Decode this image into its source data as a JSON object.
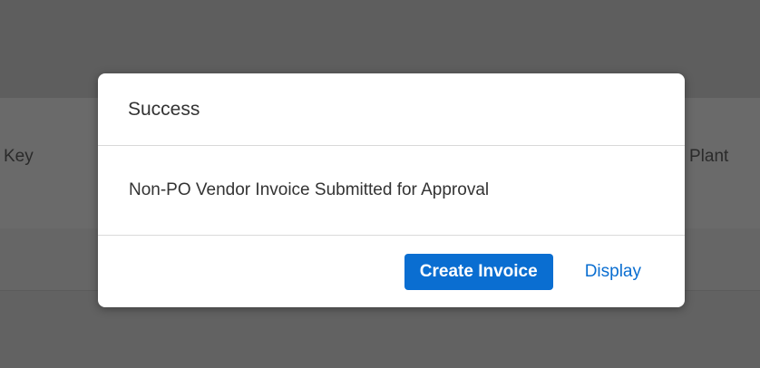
{
  "background": {
    "columns": [
      "Key",
      "Plant"
    ]
  },
  "dialog": {
    "title": "Success",
    "message": "Non-PO Vendor Invoice Submitted for Approval",
    "primary_button": "Create Invoice",
    "secondary_button": "Display"
  },
  "colors": {
    "accent": "#0a6ed1",
    "overlay": "#6b6b6b",
    "dialog_bg": "#ffffff"
  }
}
